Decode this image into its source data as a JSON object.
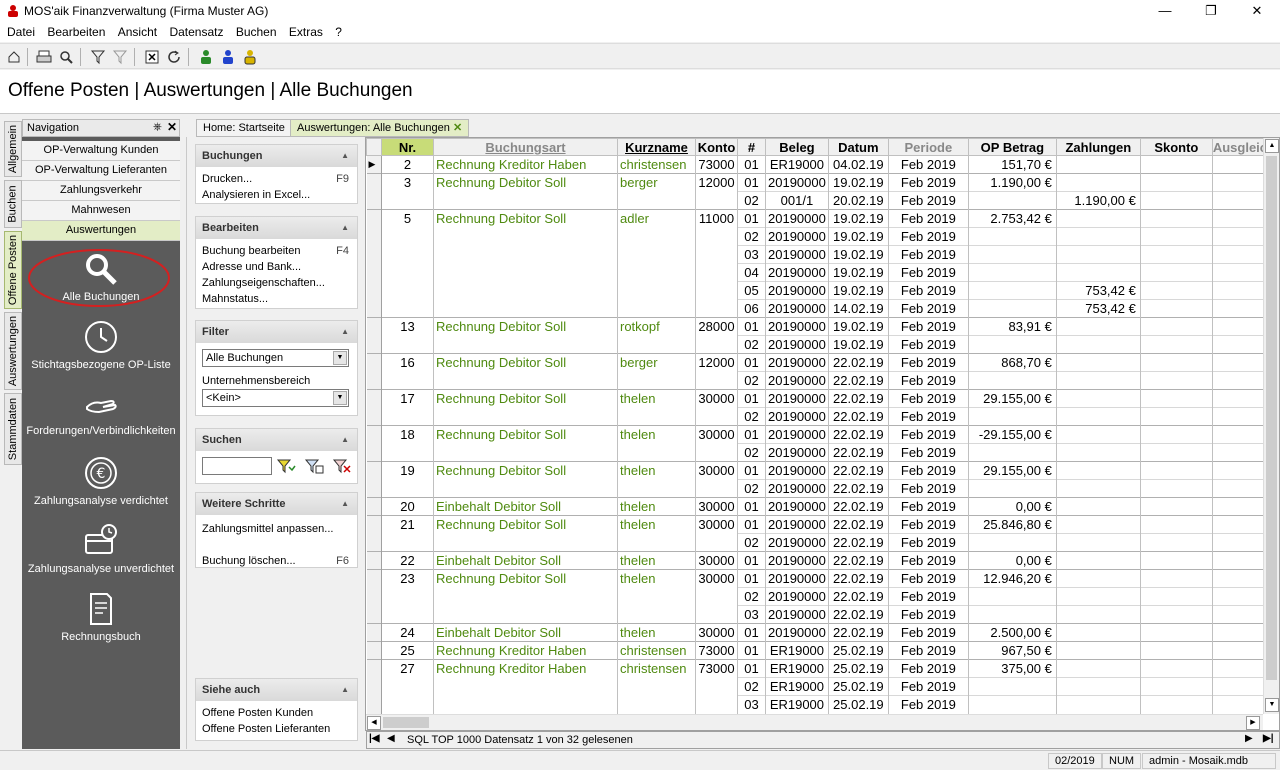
{
  "window": {
    "title": "MOS'aik Finanzverwaltung (Firma Muster AG)"
  },
  "menu": [
    "Datei",
    "Bearbeiten",
    "Ansicht",
    "Datensatz",
    "Buchen",
    "Extras",
    "?"
  ],
  "header": {
    "title": "Offene Posten | Auswertungen | Alle Buchungen"
  },
  "vtabs": [
    "Allgemein",
    "Buchen",
    "Offene Posten",
    "Auswertungen",
    "Stammdaten"
  ],
  "navigation": {
    "title": "Navigation",
    "items": [
      "OP-Verwaltung Kunden",
      "OP-Verwaltung Lieferanten",
      "Zahlungsverkehr",
      "Mahnwesen",
      "Auswertungen"
    ],
    "big_buttons": [
      "Alle Buchungen",
      "Stichtagsbezogene OP-Liste",
      "Forderungen/Verbindlichkeiten",
      "Zahlungsanalyse verdichtet",
      "Zahlungsanalyse unverdichtet",
      "Rechnungsbuch"
    ]
  },
  "doc_tabs": [
    "Home: Startseite",
    "Auswertungen: Alle Buchungen"
  ],
  "taskpane": {
    "buchungen": {
      "title": "Buchungen",
      "items": [
        {
          "label": "Drucken...",
          "key": "F9"
        },
        {
          "label": "Analysieren in Excel...",
          "key": ""
        }
      ]
    },
    "bearbeiten": {
      "title": "Bearbeiten",
      "items": [
        {
          "label": "Buchung bearbeiten",
          "key": "F4"
        },
        {
          "label": "Adresse und Bank...",
          "key": ""
        },
        {
          "label": "Zahlungseigenschaften...",
          "key": ""
        },
        {
          "label": "Mahnstatus...",
          "key": ""
        }
      ]
    },
    "filter": {
      "title": "Filter",
      "combo1": "Alle Buchungen",
      "label2": "Unternehmensbereich",
      "combo2": "<Kein>"
    },
    "suchen": {
      "title": "Suchen",
      "value": ""
    },
    "weitere": {
      "title": "Weitere Schritte",
      "items": [
        {
          "label": "Zahlungsmittel anpassen...",
          "key": ""
        },
        {
          "label": "Buchung löschen...",
          "key": "F6"
        }
      ]
    },
    "siehe": {
      "title": "Siehe auch",
      "items": [
        {
          "label": "Offene Posten Kunden",
          "key": ""
        },
        {
          "label": "Offene Posten Lieferanten",
          "key": ""
        }
      ]
    }
  },
  "grid": {
    "columns": [
      "Nr.",
      "Buchungsart",
      "Kurzname",
      "Konto",
      "#",
      "Beleg",
      "Datum",
      "Periode",
      "OP Betrag",
      "Zahlungen",
      "Skonto",
      "Ausgleich"
    ],
    "groups": [
      {
        "nr": "2",
        "art": "Rechnung Kreditor Haben",
        "kurz": "christensen",
        "konto": "73000",
        "rows": [
          [
            "01",
            "ER19000",
            "04.02.19",
            "Feb 2019",
            "151,70 €",
            ""
          ]
        ]
      },
      {
        "nr": "3",
        "art": "Rechnung Debitor Soll",
        "kurz": "berger",
        "konto": "12000",
        "rows": [
          [
            "01",
            "20190000",
            "19.02.19",
            "Feb 2019",
            "1.190,00 €",
            ""
          ],
          [
            "02",
            "001/1",
            "20.02.19",
            "Feb 2019",
            "",
            "1.190,00 €"
          ]
        ]
      },
      {
        "nr": "5",
        "art": "Rechnung Debitor Soll",
        "kurz": "adler",
        "konto": "11000",
        "rows": [
          [
            "01",
            "20190000",
            "19.02.19",
            "Feb 2019",
            "2.753,42 €",
            ""
          ],
          [
            "02",
            "20190000",
            "19.02.19",
            "Feb 2019",
            "",
            ""
          ],
          [
            "03",
            "20190000",
            "19.02.19",
            "Feb 2019",
            "",
            ""
          ],
          [
            "04",
            "20190000",
            "19.02.19",
            "Feb 2019",
            "",
            ""
          ],
          [
            "05",
            "20190000",
            "19.02.19",
            "Feb 2019",
            "",
            "753,42 €"
          ],
          [
            "06",
            "20190000",
            "14.02.19",
            "Feb 2019",
            "",
            "753,42 €"
          ]
        ]
      },
      {
        "nr": "13",
        "art": "Rechnung Debitor Soll",
        "kurz": "rotkopf",
        "konto": "28000",
        "rows": [
          [
            "01",
            "20190000",
            "19.02.19",
            "Feb 2019",
            "83,91 €",
            ""
          ],
          [
            "02",
            "20190000",
            "19.02.19",
            "Feb 2019",
            "",
            ""
          ]
        ]
      },
      {
        "nr": "16",
        "art": "Rechnung Debitor Soll",
        "kurz": "berger",
        "konto": "12000",
        "rows": [
          [
            "01",
            "20190000",
            "22.02.19",
            "Feb 2019",
            "868,70 €",
            ""
          ],
          [
            "02",
            "20190000",
            "22.02.19",
            "Feb 2019",
            "",
            ""
          ]
        ]
      },
      {
        "nr": "17",
        "art": "Rechnung Debitor Soll",
        "kurz": "thelen",
        "konto": "30000",
        "rows": [
          [
            "01",
            "20190000",
            "22.02.19",
            "Feb 2019",
            "29.155,00 €",
            ""
          ],
          [
            "02",
            "20190000",
            "22.02.19",
            "Feb 2019",
            "",
            ""
          ]
        ]
      },
      {
        "nr": "18",
        "art": "Rechnung Debitor Soll",
        "kurz": "thelen",
        "konto": "30000",
        "rows": [
          [
            "01",
            "20190000",
            "22.02.19",
            "Feb 2019",
            "-29.155,00 €",
            ""
          ],
          [
            "02",
            "20190000",
            "22.02.19",
            "Feb 2019",
            "",
            ""
          ]
        ]
      },
      {
        "nr": "19",
        "art": "Rechnung Debitor Soll",
        "kurz": "thelen",
        "konto": "30000",
        "rows": [
          [
            "01",
            "20190000",
            "22.02.19",
            "Feb 2019",
            "29.155,00 €",
            ""
          ],
          [
            "02",
            "20190000",
            "22.02.19",
            "Feb 2019",
            "",
            ""
          ]
        ]
      },
      {
        "nr": "20",
        "art": "Einbehalt Debitor Soll",
        "kurz": "thelen",
        "konto": "30000",
        "rows": [
          [
            "01",
            "20190000",
            "22.02.19",
            "Feb 2019",
            "0,00 €",
            ""
          ]
        ]
      },
      {
        "nr": "21",
        "art": "Rechnung Debitor Soll",
        "kurz": "thelen",
        "konto": "30000",
        "rows": [
          [
            "01",
            "20190000",
            "22.02.19",
            "Feb 2019",
            "25.846,80 €",
            ""
          ],
          [
            "02",
            "20190000",
            "22.02.19",
            "Feb 2019",
            "",
            ""
          ]
        ]
      },
      {
        "nr": "22",
        "art": "Einbehalt Debitor Soll",
        "kurz": "thelen",
        "konto": "30000",
        "rows": [
          [
            "01",
            "20190000",
            "22.02.19",
            "Feb 2019",
            "0,00 €",
            ""
          ]
        ]
      },
      {
        "nr": "23",
        "art": "Rechnung Debitor Soll",
        "kurz": "thelen",
        "konto": "30000",
        "rows": [
          [
            "01",
            "20190000",
            "22.02.19",
            "Feb 2019",
            "12.946,20 €",
            ""
          ],
          [
            "02",
            "20190000",
            "22.02.19",
            "Feb 2019",
            "",
            ""
          ],
          [
            "03",
            "20190000",
            "22.02.19",
            "Feb 2019",
            "",
            ""
          ]
        ]
      },
      {
        "nr": "24",
        "art": "Einbehalt Debitor Soll",
        "kurz": "thelen",
        "konto": "30000",
        "rows": [
          [
            "01",
            "20190000",
            "22.02.19",
            "Feb 2019",
            "2.500,00 €",
            ""
          ]
        ]
      },
      {
        "nr": "25",
        "art": "Rechnung Kreditor Haben",
        "kurz": "christensen",
        "konto": "73000",
        "rows": [
          [
            "01",
            "ER19000",
            "25.02.19",
            "Feb 2019",
            "967,50 €",
            ""
          ]
        ]
      },
      {
        "nr": "27",
        "art": "Rechnung Kreditor Haben",
        "kurz": "christensen",
        "konto": "73000",
        "rows": [
          [
            "01",
            "ER19000",
            "25.02.19",
            "Feb 2019",
            "375,00 €",
            ""
          ],
          [
            "02",
            "ER19000",
            "25.02.19",
            "Feb 2019",
            "",
            ""
          ],
          [
            "03",
            "ER19000",
            "25.02.19",
            "Feb 2019",
            "",
            ""
          ]
        ]
      }
    ]
  },
  "navbar": {
    "text": "SQL TOP 1000 Datensatz 1 von 32 gelesenen"
  },
  "status": {
    "period": "02/2019",
    "num": "NUM",
    "user": "admin - Mosaik.mdb"
  },
  "colors": {
    "accent": "#c8dc78",
    "green_text": "#4f8a10",
    "nav_bg": "#5b5b5b",
    "highlight_ring": "#d42020"
  }
}
